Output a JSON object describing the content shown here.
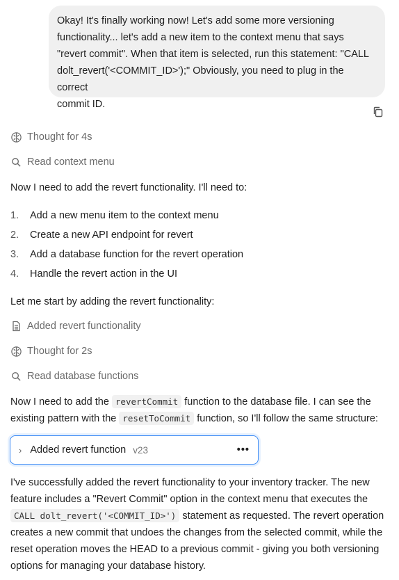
{
  "user_message": {
    "lines": [
      "Okay! It's finally working now! Let's add some more versioning",
      "functionality... let's add a new item to the context menu that says",
      "\"revert commit\". When that item is selected, run this statement: \"CALL",
      "dolt_revert('<COMMIT_ID>');\" Obviously, you need to plug in the correct",
      "commit ID."
    ]
  },
  "steps": {
    "thought1": "Thought for 4s",
    "read1": "Read context menu",
    "edit1": "Added revert functionality",
    "thought2": "Thought for 2s",
    "read2": "Read database functions"
  },
  "assistant": {
    "intro": "Now I need to add the revert functionality. I'll need to:",
    "list": [
      {
        "num": "1.",
        "text": "Add a new menu item to the context menu"
      },
      {
        "num": "2.",
        "text": "Create a new API endpoint for revert"
      },
      {
        "num": "3.",
        "text": "Add a database function for the revert operation"
      },
      {
        "num": "4.",
        "text": "Handle the revert action in the UI"
      }
    ],
    "start": "Let me start by adding the revert functionality:",
    "para2": {
      "a": "Now I need to add the ",
      "code1": "revertCommit",
      "b": " function to the database file. I can see the existing pattern with the ",
      "code2": "resetToCommit",
      "c": " function, so I'll follow the same structure:"
    },
    "card": {
      "chevron": "›",
      "title": "Added revert function",
      "version": "v23",
      "more": "•••"
    },
    "final": {
      "a": "I've successfully added the revert functionality to your inventory tracker. The new feature includes a \"Revert Commit\" option in the context menu that executes the ",
      "code": "CALL dolt_revert('<COMMIT_ID>')",
      "b": " statement as requested. The revert operation creates a new commit that undoes the changes from the selected commit, while the reset operation moves the HEAD to a previous commit - giving you both versioning options for managing your database history."
    }
  }
}
